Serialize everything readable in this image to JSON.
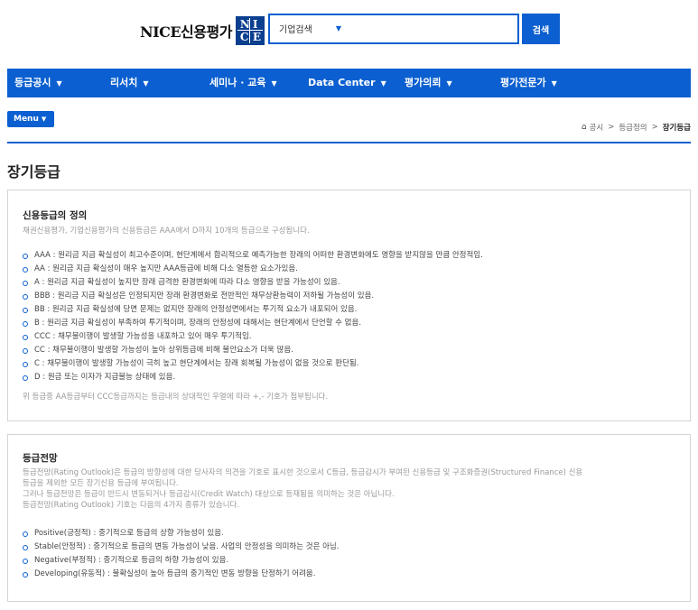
{
  "header": {
    "logo_text": "NICE신용평가",
    "logo_letters": [
      "N",
      "I",
      "C",
      "E"
    ],
    "search": {
      "select_value": "기업검색",
      "placeholder": "",
      "button_label": "검색"
    }
  },
  "nav": {
    "items": [
      {
        "label": "등급공시"
      },
      {
        "label": "리서치"
      },
      {
        "label": "세미나 · 교육"
      },
      {
        "label": "Data Center"
      },
      {
        "label": "평가의뢰"
      },
      {
        "label": "평가전문가"
      }
    ]
  },
  "menu_label": "Menu",
  "breadcrumb": {
    "items": [
      "공시",
      "등급정의"
    ],
    "current": "장기등급"
  },
  "page_title": "장기등급",
  "section1": {
    "title": "신용등급의 정의",
    "desc": "채권신용평가, 기업신용평가의 신용등급은 AAA에서 D까지 10개의 등급으로 구성됩니다.",
    "items": [
      "AAA : 원리금 지급 확실성이 최고수준이며, 현단계에서 합리적으로 예측가능한 장래의 어떠한 환경변화에도 영향을 받지않을 만큼 안정적임.",
      "AA : 원리금 지급 확실성이 매우 높지만 AAA등급에 비해 다소 열등한 요소가있음.",
      "A : 원리금 지급 확실성이 높지만 장래 급격한 환경변화에 따라 다소 영향을 받을 가능성이 있음.",
      "BBB : 원리금 지급 확실성은 인정되지만 장래 환경변화로 전반적인 채무상환능력이 저하될 가능성이 있음.",
      "BB : 원리금 지급 확실성에 당면 문제는 없지만 장래의 안정성면에서는 투기적 요소가 내포되어 있음.",
      "B : 원리금 지급 확실성이 부족하여 투기적이며, 장래의 안정성에 대해서는 현단계에서 단언할 수 없음.",
      "CCC : 채무불이행이 발생할 가능성을 내포하고 있어 매우 투기적임.",
      "CC : 채무불이행이 발생할 가능성이 높아 상위등급에 비해 불안요소가 더욱 많음.",
      "C : 채무불이행이 발생할 가능성이 극히 높고 현단계에서는 장래 회복될 가능성이 없을 것으로 판단됨.",
      "D : 원금 또는 이자가 지급불능 상태에 있음."
    ],
    "note": "위 등급중 AA등급부터 CCC등급까지는 등급내의 상대적인 우열에 따라 +,- 기호가 첨부됩니다."
  },
  "section2": {
    "title": "등급전망",
    "desc_lines": [
      "등급전망(Rating Outlook)은 등급의 방향성에 대한 당사자의 의견을 기호로 표시한 것으로서 C등급, 등급감시가 부여된 신용등급 및 구조화증권(Structured Finance) 신용",
      "등급을 제외한 모든 장기신용 등급에 부여됩니다.",
      "그러나 등급전망은 등급이 반드시 변동되거나 등급감시(Credit Watch) 대상으로 등재됨을 의미하는 것은 아닙니다.",
      "등급전망(Rating Outlook) 기호는 다음의 4가지 종류가 있습니다."
    ],
    "items": [
      "Positive(긍정적) : 중기적으로 등급의 상향 가능성이 있음.",
      "Stable(안정적) : 중기적으로 등급의 변동 가능성이 낮음. 사업의 안정성을 의미하는 것은 아님.",
      "Negative(부정적) : 중기적으로 등급의 하향 가능성이 있음.",
      "Developing(유동적) : 불확실성이 높아 등급의 중기적인 변동 방향을 단정하기 어려움."
    ]
  },
  "colors": {
    "brand_blue": "#0b5fd0",
    "logo_navy": "#0b3f8f"
  }
}
